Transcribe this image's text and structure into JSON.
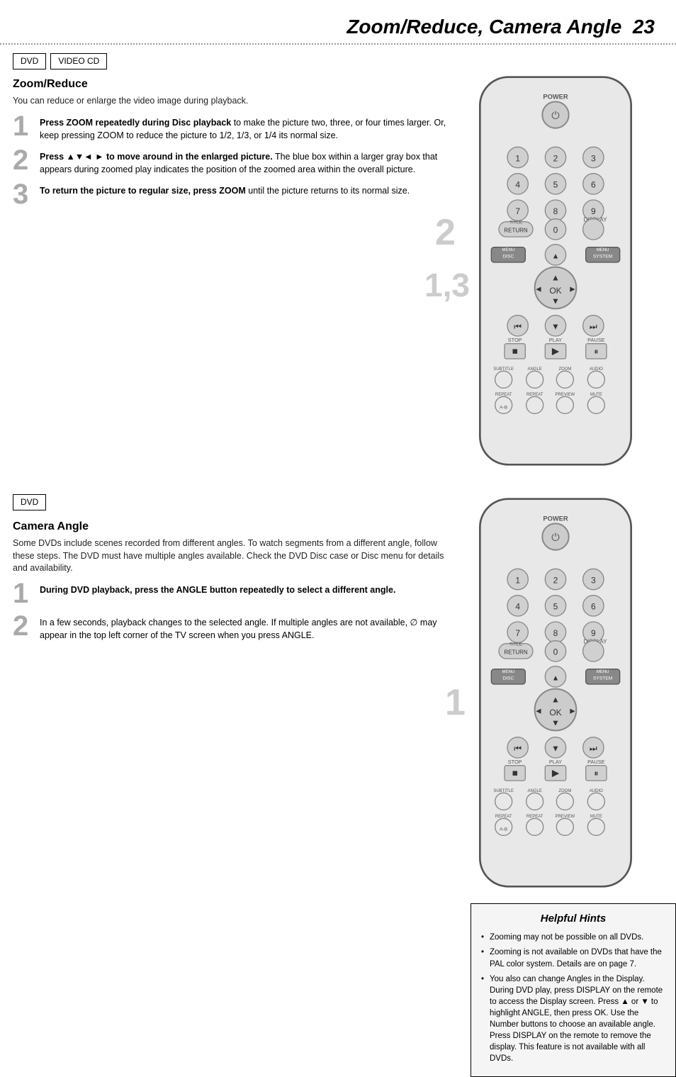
{
  "header": {
    "title": "Zoom/Reduce, Camera Angle",
    "page_number": "23"
  },
  "zoom_section": {
    "dvd_badge": "DVD",
    "videocd_badge": "VIDEO CD",
    "heading": "Zoom/Reduce",
    "subtext": "You can reduce or enlarge the video image during playback.",
    "steps": [
      {
        "number": "1",
        "text_html": "<b>Press ZOOM repeatedly during Disc playback</b> to make the picture two, three, or four times larger. Or, keep pressing ZOOM to reduce the picture to 1/2, 1/3, or 1/4 its normal size."
      },
      {
        "number": "2",
        "text_html": "<b>Press ▲▼◄ ► to move around in the enlarged picture.</b> The blue box within a larger gray box that appears during zoomed play indicates the position of the zoomed area within the overall picture."
      },
      {
        "number": "3",
        "text_html": "<b>To return the picture to regular size, press ZOOM</b> until the picture returns to its normal size."
      }
    ],
    "step_labels_remote": [
      "2",
      "1,3"
    ]
  },
  "camera_section": {
    "dvd_badge": "DVD",
    "heading": "Camera Angle",
    "subtext": "Some DVDs include scenes recorded from different angles. To watch segments from a different angle, follow these steps. The DVD must have multiple angles available. Check the DVD Disc case or Disc menu for details and availability.",
    "steps": [
      {
        "number": "1",
        "text_html": "<b>During DVD playback, press the ANGLE button repeatedly to select a different angle.</b>"
      },
      {
        "number": "2",
        "text_html": "In a few seconds, playback changes to the selected angle. If multiple angles are not available, ∅ may appear in the top left corner of the TV screen when you press ANGLE."
      }
    ],
    "step_label_remote": "1"
  },
  "hints": {
    "title": "Helpful Hints",
    "items": [
      "Zooming may not be possible on all DVDs.",
      "Zooming is not available on DVDs that have the PAL color system. Details are on page 7.",
      "You also can change Angles in the Display. During DVD play, press DISPLAY on the remote to access the Display screen. Press ▲ or ▼ to highlight ANGLE, then press OK. Use the Number buttons to choose an available angle. Press DISPLAY on the remote to remove the display. This feature is not available with all DVDs."
    ]
  }
}
